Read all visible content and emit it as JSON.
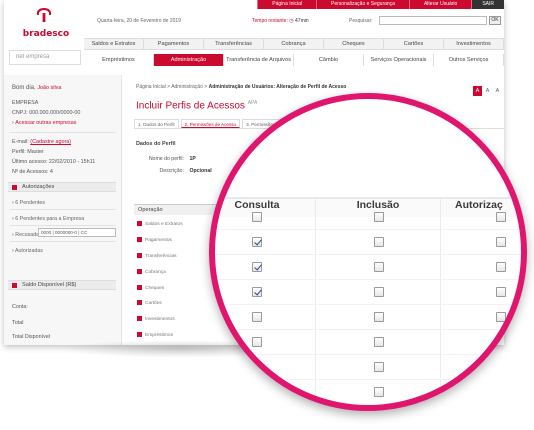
{
  "top_links": [
    "Página Inicial",
    "Personalização e Segurança",
    "Alterar Usuário",
    "SAIR"
  ],
  "brand": {
    "name": "bradesco",
    "product": "net empresa",
    "color": "#cc092f"
  },
  "header": {
    "date": "Quarta-feira, 20 de Fevereiro de 2019",
    "timer_label": "Tempo restante:",
    "timer_value": "47min",
    "search_label": "Pesquisar:",
    "search_value": "",
    "search_button": "OK"
  },
  "nav_top": [
    "Saldos e Extratos",
    "Pagamentos",
    "Transferências",
    "Cobrança",
    "Cheques",
    "Cartões",
    "Investimentos"
  ],
  "nav_bottom": [
    {
      "label": "Empréstimos",
      "active": false
    },
    {
      "label": "Administração",
      "active": true
    },
    {
      "label": "Transferência de Arquivos",
      "active": false
    },
    {
      "label": "Câmbio",
      "active": false
    },
    {
      "label": "Serviços Operacionais",
      "active": false
    },
    {
      "label": "Outros Serviços",
      "active": false
    }
  ],
  "sidebar": {
    "greeting": "Bom dia,",
    "user": "João silva",
    "company": "EMPRESA",
    "cnpj": "CNPJ: 000.000.000/0000-00",
    "switch_company": "Acessar outras empresas",
    "email_label": "E-mail:",
    "email_link": "(Cadastre agora)",
    "profile": "Perfil: Master",
    "last_access": "Último acesso: 22/02/2010 - 15h11",
    "access_count": "Nº de Acessos: 4",
    "section_auth": "Autorizações",
    "auth_links": [
      "6 Pendentes",
      "6 Pendentes para a Empresa",
      "Recusadas e Expiradas",
      "Autorizadas"
    ],
    "section_balance": "Saldo Disponível (R$)",
    "account_label": "Conta:",
    "account_value": "0000 | 0000000-0 | CC",
    "total_label": "Total",
    "total_available": "Total Disponível"
  },
  "main": {
    "breadcrumb": [
      "Página Inicial",
      "Administração"
    ],
    "breadcrumb_current": "Administração de Usuários: Alteração de Perfil de Acesso",
    "title": "Incluir Perfis de Acessos",
    "title_tag": "APA",
    "font_sizes": [
      "A",
      "A",
      "A"
    ],
    "steps": [
      "1. Dados do Perfil",
      "2. Permissões de Acesso",
      "3. Permissões de"
    ],
    "section_title": "Dados do Perfil",
    "profile_name_label": "Nome do perfil:",
    "profile_name_value": "1P",
    "description_label": "Descrição:",
    "description_value": "Opcional",
    "operation_header": "Operação",
    "operations": [
      "Saldos e Extratos",
      "Pagamentos",
      "Transferências",
      "Cobrança",
      "Cheques",
      "Cartões",
      "Investimentos",
      "Empréstimos"
    ]
  },
  "magnifier": {
    "columns": [
      "Consulta",
      "Inclusão",
      "Autorizaç"
    ],
    "rows": [
      [
        false,
        false,
        false
      ],
      [
        true,
        false,
        false
      ],
      [
        true,
        false,
        false
      ],
      [
        true,
        false,
        false
      ],
      [
        false,
        false,
        false
      ],
      [
        false,
        false,
        false
      ],
      [
        false,
        false,
        false
      ],
      [
        false,
        false,
        false
      ],
      [
        false,
        false,
        false
      ]
    ]
  }
}
